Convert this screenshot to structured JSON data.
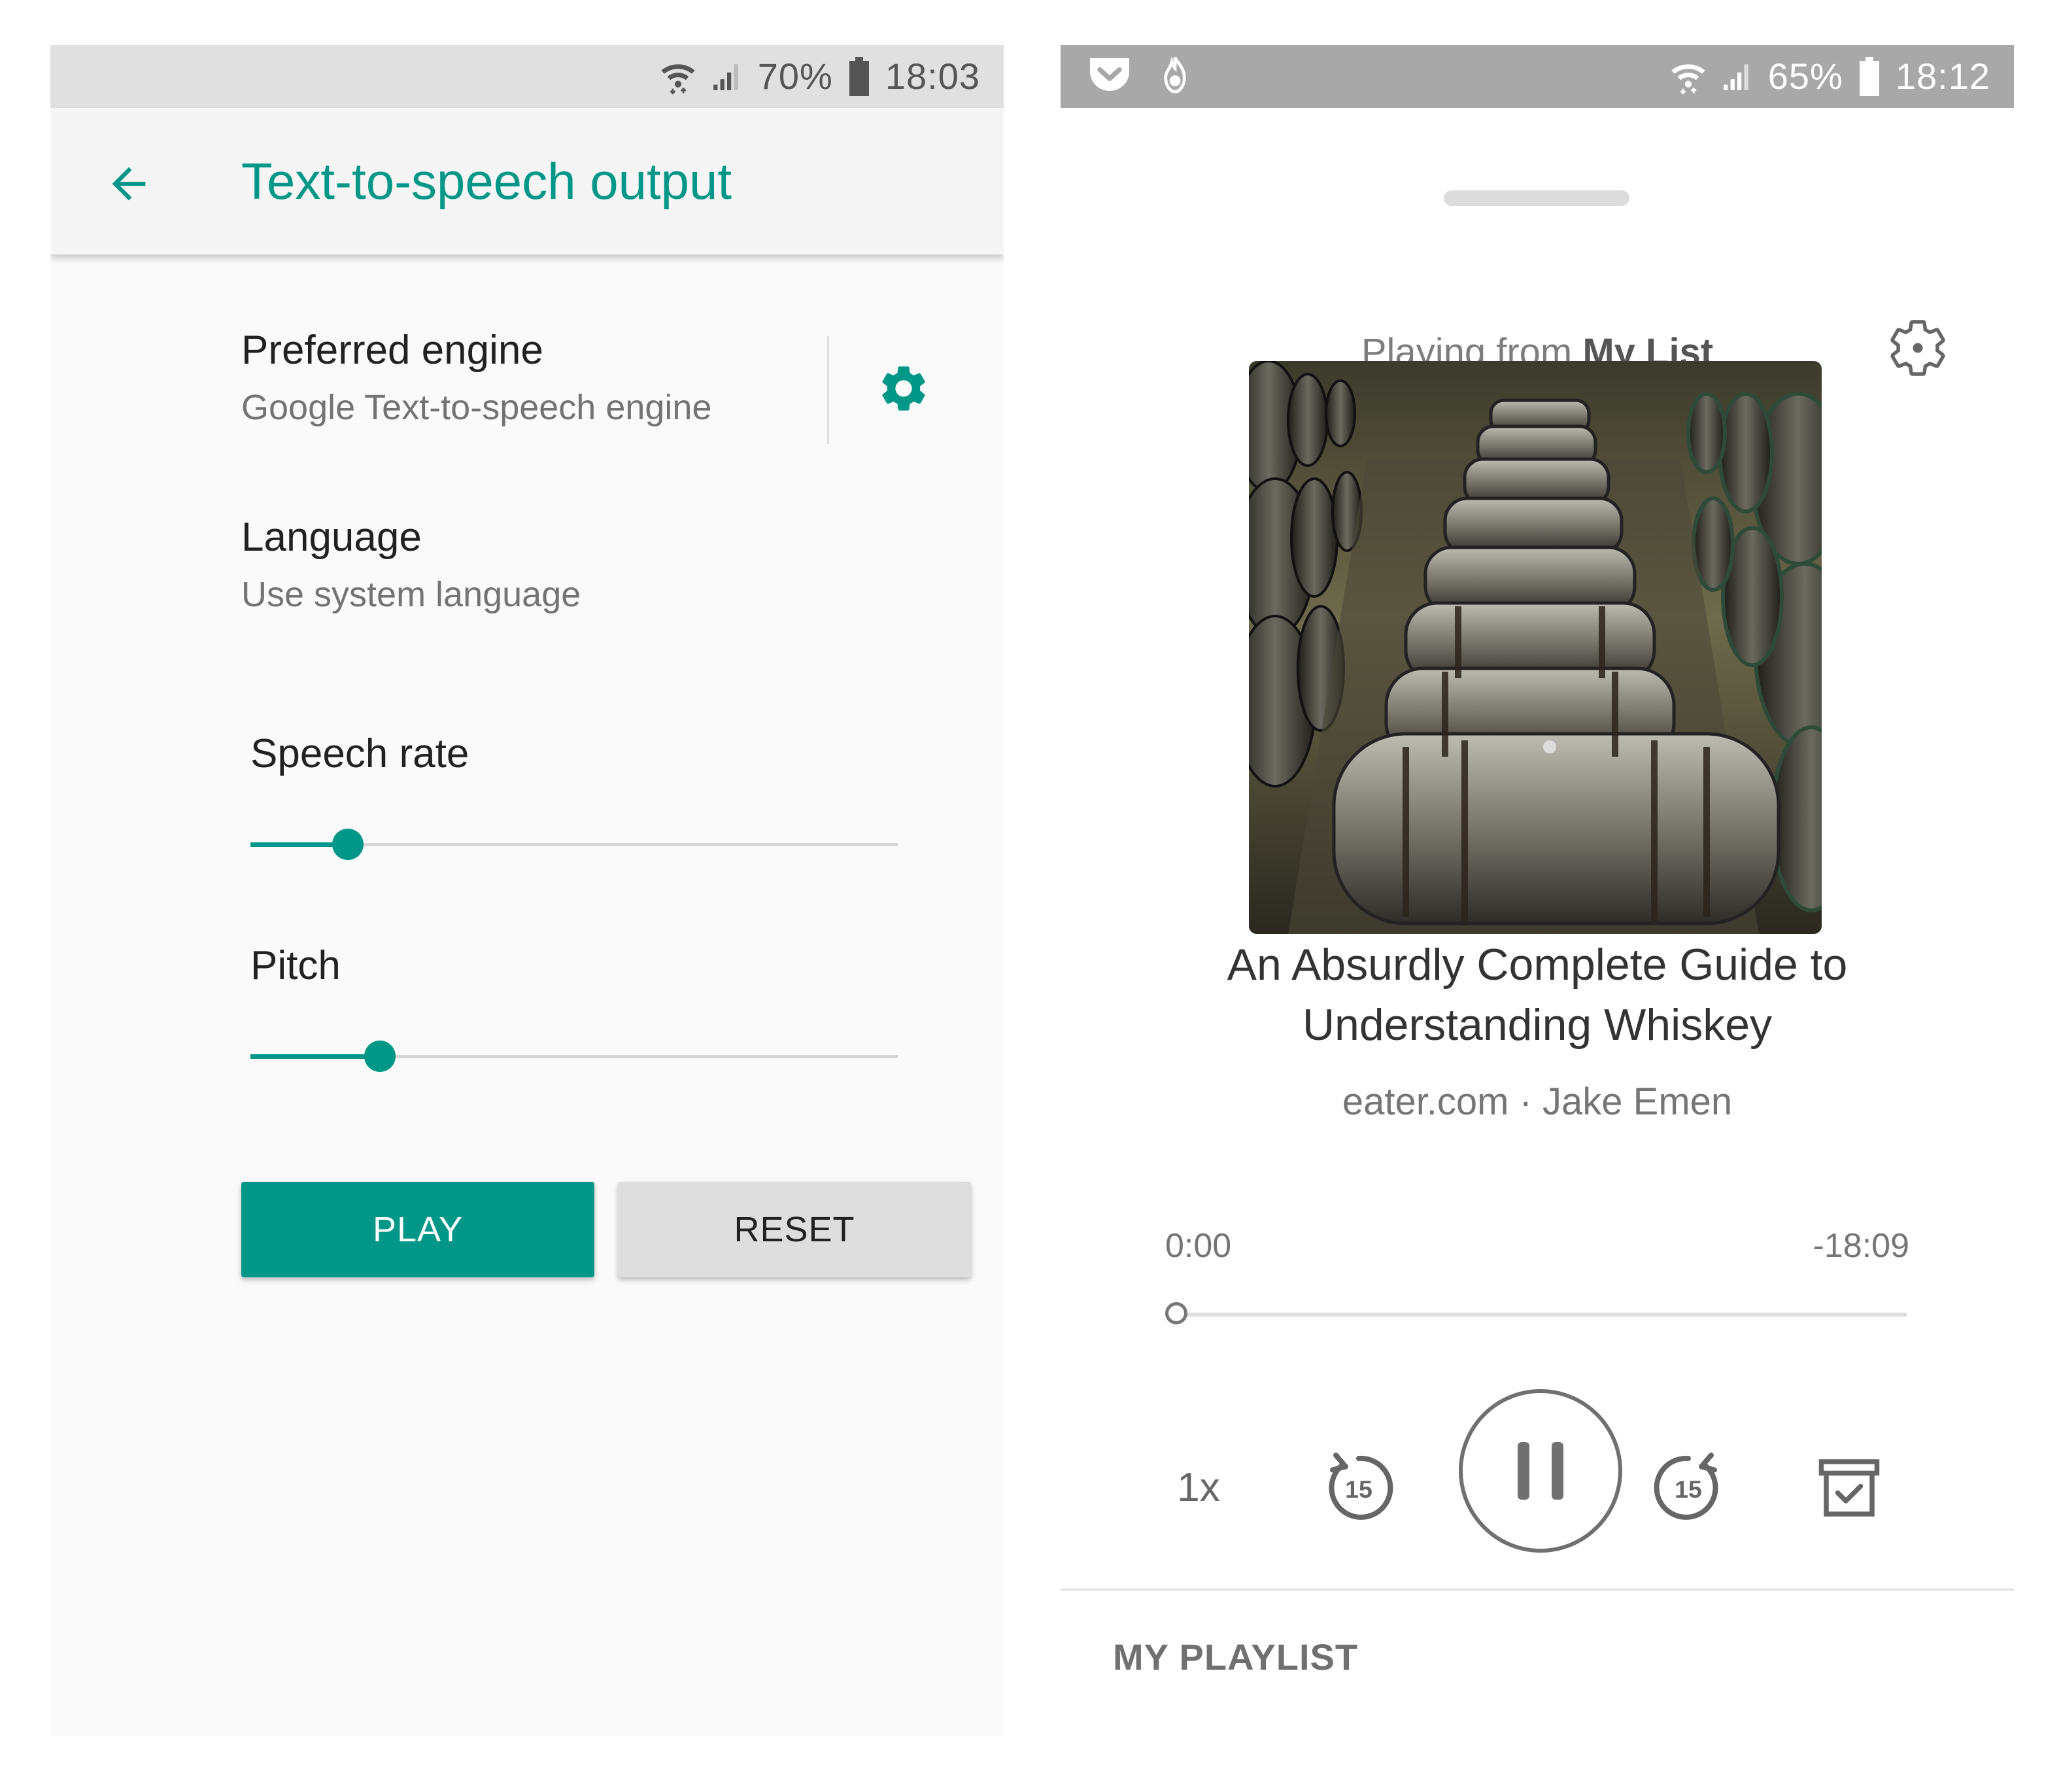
{
  "left_screen": {
    "status_bar": {
      "battery_percent": "70%",
      "time": "18:03",
      "icons": [
        "wifi-icon",
        "signal-icon",
        "battery-icon"
      ]
    },
    "app_bar": {
      "title": "Text-to-speech output",
      "back_icon": "arrow-back-icon"
    },
    "preferred_engine": {
      "title": "Preferred engine",
      "summary": "Google Text-to-speech engine",
      "settings_icon": "gear-icon"
    },
    "language": {
      "title": "Language",
      "summary": "Use system language"
    },
    "speech_rate": {
      "label": "Speech rate",
      "value_fraction": 0.15
    },
    "pitch": {
      "label": "Pitch",
      "value_fraction": 0.2
    },
    "buttons": {
      "play": "PLAY",
      "reset": "RESET"
    },
    "colors": {
      "accent": "#009688"
    }
  },
  "right_screen": {
    "status_bar": {
      "battery_percent": "65%",
      "time": "18:12",
      "left_icons": [
        "pocket-icon",
        "notification-icon"
      ],
      "icons": [
        "wifi-icon",
        "signal-icon",
        "battery-icon"
      ]
    },
    "player": {
      "playing_from_prefix": "Playing from",
      "playing_from_list": "My List",
      "settings_icon": "gear-outline-icon",
      "artwork_description_icon": "whiskey-barrels-image",
      "article_title_line1": "An Absurdly Complete Guide to",
      "article_title_line2": "Understanding Whiskey",
      "article_meta": "eater.com · Jake Emen",
      "time_elapsed": "0:00",
      "time_remaining": "-18:09",
      "progress_fraction": 0.0,
      "speed": "1x",
      "skip_back_seconds": "15",
      "skip_forward_seconds": "15",
      "controls": [
        "speed-button",
        "rewind-15-icon",
        "pause-icon",
        "forward-15-icon",
        "archive-icon"
      ]
    },
    "playlist": {
      "label": "MY PLAYLIST"
    }
  }
}
